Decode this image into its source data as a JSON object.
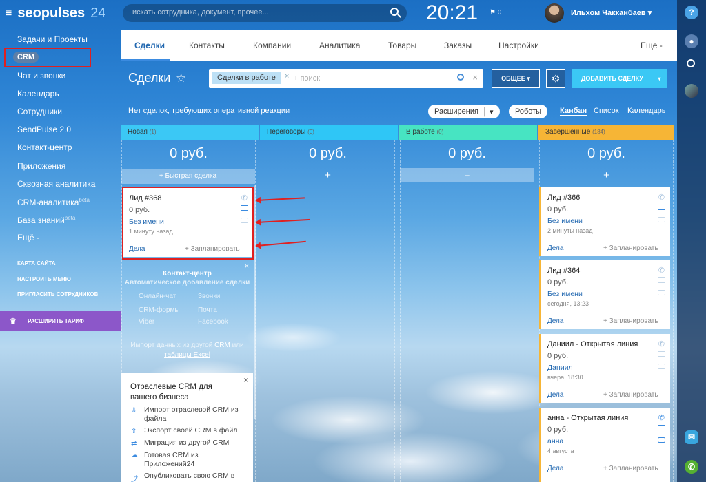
{
  "header": {
    "brand": "seopulses",
    "brand_num": "24",
    "search_placeholder": "искать сотрудника, документ, прочее...",
    "clock": "20:21",
    "flag_count": "0",
    "user_name": "Ильхом Чакканбаев"
  },
  "sidebar": {
    "items": [
      {
        "label": "Задачи и Проекты"
      },
      {
        "label": "CRM"
      },
      {
        "label": "Чат и звонки"
      },
      {
        "label": "Календарь"
      },
      {
        "label": "Сотрудники"
      },
      {
        "label": "SendPulse 2.0"
      },
      {
        "label": "Контакт-центр"
      },
      {
        "label": "Приложения"
      },
      {
        "label": "Сквозная аналитика"
      },
      {
        "label": "CRM-аналитика",
        "sup": "beta"
      },
      {
        "label": "База знаний",
        "sup": "beta"
      },
      {
        "label": "Ещё -"
      }
    ],
    "links": [
      "КАРТА САЙТА",
      "НАСТРОИТЬ МЕНЮ",
      "ПРИГЛАСИТЬ СОТРУДНИКОВ"
    ],
    "upgrade": "РАСШИРИТЬ ТАРИФ"
  },
  "tabs": [
    {
      "label": "Сделки"
    },
    {
      "label": "Контакты"
    },
    {
      "label": "Компании"
    },
    {
      "label": "Аналитика"
    },
    {
      "label": "Товары"
    },
    {
      "label": "Заказы"
    },
    {
      "label": "Настройки"
    },
    {
      "label": "Еще -"
    }
  ],
  "page": {
    "title": "Сделки",
    "filter_chip": "Сделки в работе",
    "filter_placeholder": "+ поиск",
    "btn_general": "ОБЩЕЕ",
    "btn_add": "ДОБАВИТЬ СДЕЛКУ",
    "notice": "Нет сделок, требующих оперативной реакции",
    "btn_extensions": "Расширения",
    "btn_robots": "Роботы",
    "views": [
      "Канбан",
      "Список",
      "Календарь"
    ]
  },
  "colors": {
    "col_new": "#3bc8f5",
    "col_nego": "#2fc6f6",
    "col_work": "#47e4c2",
    "col_done": "#f6b536"
  },
  "columns": [
    {
      "name": "Новая",
      "count": "(1)",
      "sum": "0 руб.",
      "add_label": "+ Быстрая сделка"
    },
    {
      "name": "Переговоры",
      "count": "(0)",
      "sum": "0 руб.",
      "add_label": "+"
    },
    {
      "name": "В работе",
      "count": "(0)",
      "sum": "0 руб.",
      "add_label": "+"
    },
    {
      "name": "Завершенные",
      "count": "(184)",
      "sum": "0 руб.",
      "add_label": "+"
    }
  ],
  "card_new": {
    "title": "Лид #368",
    "sum": "0 руб.",
    "client": "Без имени",
    "date": "1 минуту назад",
    "deals": "Дела",
    "plan": "+ Запланировать"
  },
  "cards_done": [
    {
      "title": "Лид #366",
      "sum": "0 руб.",
      "client": "Без имени",
      "date": "2 минуты назад",
      "deals": "Дела",
      "plan": "+ Запланировать"
    },
    {
      "title": "Лид #364",
      "sum": "0 руб.",
      "client": "Без имени",
      "date": "сегодня, 13:23",
      "deals": "Дела",
      "plan": "+ Запланировать"
    },
    {
      "title": "Даниил - Открытая линия",
      "sum": "0 руб.",
      "client": "Даниил",
      "date": "вчера, 18:30",
      "deals": "Дела",
      "plan": "+ Запланировать"
    },
    {
      "title": "анна - Открытая линия",
      "sum": "0 руб.",
      "client": "анна",
      "date": "4 августа",
      "deals": "Дела",
      "plan": "+ Запланировать"
    }
  ],
  "promo": {
    "title": "Контакт-центр",
    "subtitle": "Автоматическое добавление сделки",
    "items": [
      "Онлайн-чат",
      "Звонки",
      "CRM-формы",
      "Почта",
      "Viber",
      "Facebook"
    ],
    "bottom_text": "Импорт данных из другой",
    "bottom_link1": "CRM",
    "bottom_mid": "или",
    "bottom_link2": "таблицы Excel"
  },
  "industry": {
    "title": "Отраслевые CRM для вашего бизнеса",
    "items": [
      "Импорт отраслевой CRM из файла",
      "Экспорт своей CRM в файл",
      "Миграция из другой CRM",
      "Готовая CRM из Приложений24",
      "Опубликовать свою CRM в"
    ]
  }
}
